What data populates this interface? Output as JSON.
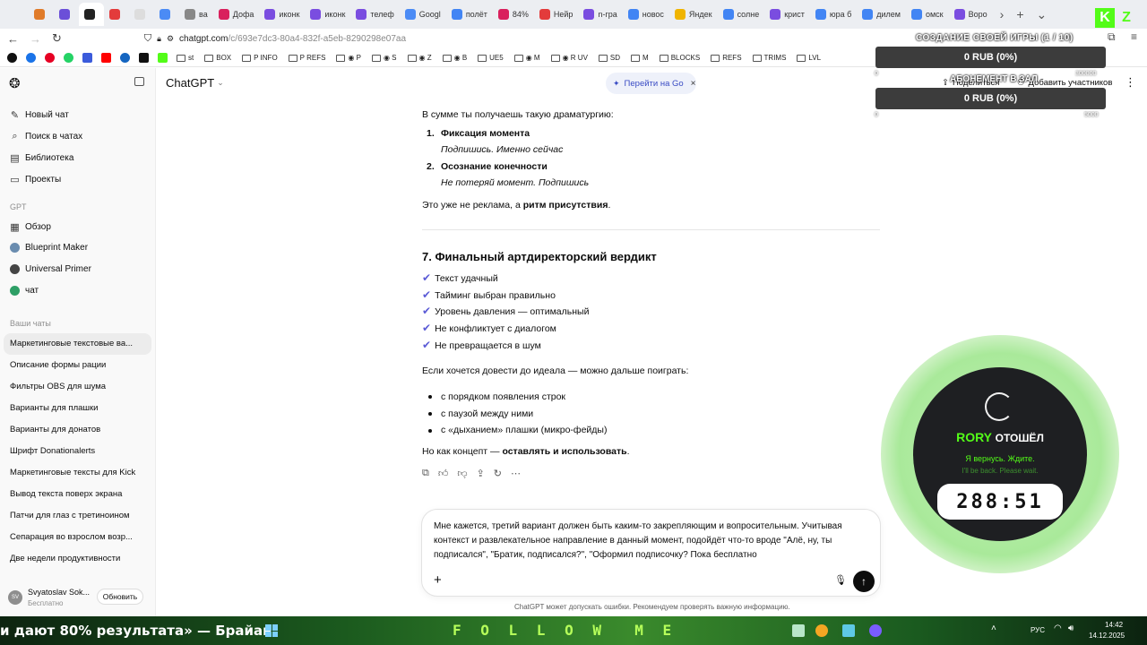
{
  "browser": {
    "tabs": [
      {
        "label": "",
        "color": "#e07b2a"
      },
      {
        "label": "",
        "color": "#6b4fd8"
      },
      {
        "label": "",
        "color": "#222222"
      },
      {
        "label": "",
        "color": "#e33b3b"
      },
      {
        "label": "",
        "color": "#dddddd"
      },
      {
        "label": "",
        "color": "#4b8bf5"
      },
      {
        "label": "вa",
        "color": "#888888"
      },
      {
        "label": "Дофа",
        "color": "#d9205d"
      },
      {
        "label": "иконк",
        "color": "#7a4de0"
      },
      {
        "label": "иконк",
        "color": "#7a4de0"
      },
      {
        "label": "телеф",
        "color": "#7a4de0"
      },
      {
        "label": "Googl",
        "color": "#4b8bf5"
      },
      {
        "label": "полёт",
        "color": "#4285f4"
      },
      {
        "label": "84% ",
        "color": "#d9205d"
      },
      {
        "label": "Нейр",
        "color": "#e33b3b"
      },
      {
        "label": "n-грa",
        "color": "#7a4de0"
      },
      {
        "label": "новос",
        "color": "#4285f4"
      },
      {
        "label": "Яндек",
        "color": "#f0b400"
      },
      {
        "label": "солне",
        "color": "#4285f4"
      },
      {
        "label": "крист",
        "color": "#7a4de0"
      },
      {
        "label": "юра б",
        "color": "#4285f4"
      },
      {
        "label": "дилем",
        "color": "#4285f4"
      },
      {
        "label": "омск ",
        "color": "#4285f4"
      },
      {
        "label": "Воро",
        "color": "#7a4de0"
      }
    ],
    "url_host": "chatgpt.com",
    "url_path": "/c/693e7dc3-80a4-832f-a5eb-8290298e07aa",
    "bookmarks": [
      "st",
      "BOX",
      "P INFO",
      "P REFS",
      "◉ P",
      "◉ S",
      "◉ Z",
      "◉ B",
      "UE5",
      "◉ M",
      "◉ R UV",
      "SD",
      "M",
      "BLOCKS",
      "REFS",
      "TRIMS",
      "LVL"
    ]
  },
  "sidebar": {
    "nav": [
      {
        "label": "Новый чат",
        "icon": "edit-icon"
      },
      {
        "label": "Поиск в чатах",
        "icon": "search-icon"
      },
      {
        "label": "Библиотека",
        "icon": "library-icon"
      },
      {
        "label": "Проекты",
        "icon": "folder-icon"
      }
    ],
    "gpt_section": "GPT",
    "gpts": [
      {
        "label": "Обзор",
        "icon": "grid-icon"
      },
      {
        "label": "Blueprint Maker",
        "icon": "blueprint-avatar"
      },
      {
        "label": "Universal Primer",
        "icon": "primer-avatar"
      },
      {
        "label": "чат",
        "icon": "chat-avatar"
      }
    ],
    "chats_section": "Ваши чаты",
    "chats": [
      "Маркетинговые текстовые ва...",
      "Описание формы рации",
      "Фильтры OBS для шума",
      "Варианты для плашки",
      "Варианты для донатов",
      "Шрифт Donationalerts",
      "Маркетинговые тексты для Kick",
      "Вывод текста поверх экрана",
      "Патчи для глаз с третиноином",
      "Сепарация во взрослом возр...",
      "Две недели продуктивности"
    ],
    "user_initials": "SV",
    "user_name": "Svyatoslav Sok...",
    "user_plan": "Бесплатно",
    "upgrade_label": "Обновить"
  },
  "header": {
    "model": "ChatGPT",
    "go_banner": "Перейти на Go",
    "share": "Поделиться",
    "add_participants": "Добавить участников"
  },
  "message": {
    "intro": "В сумме ты получаешь такую драматургию:",
    "ordered": [
      {
        "num": "1.",
        "title": "Фиксация момента",
        "sub": "Подпишись. Именно сейчас"
      },
      {
        "num": "2.",
        "title": "Осознание конечности",
        "sub": "Не потеряй момент. Подпишись"
      }
    ],
    "summary_pre": "Это уже не реклама, а ",
    "summary_bold": "ритм присутствия",
    "summary_post": ".",
    "section_title": "7. Финальный артдиректорский вердикт",
    "checks": [
      "Текст удачный",
      "Тайминг выбран правильно",
      "Уровень давления — оптимальный",
      "Не конфликтует с диалогом",
      "Не превращается в шум"
    ],
    "ideal_intro": "Если хочется довести до идеала — можно дальше поиграть:",
    "bullets": [
      "с порядком появления строк",
      "с паузой между ними",
      "с «дыханием» плашки (микро-фейды)"
    ],
    "closing_pre": "Но как концепт — ",
    "closing_bold": "оставлять и использовать",
    "closing_post": "."
  },
  "composer": {
    "text": "Мне кажется, третий вариант должен быть каким-то закрепляющим и вопросительным. Учитывая контекст и развлекательное направление в данный момент, подойдёт что-то вроде \"Алё, ну, ты подписался\", \"Братик, подписался?\", \"Оформил подписочку? Пока бесплатно",
    "disclaimer": "ChatGPT может допускать ошибки. Рекомендуем проверять важную информацию."
  },
  "overlay": {
    "goal1_title": "СОЗДАНИЕ СВОЕЙ ИГРЫ (1 / 10)",
    "goal1_value": "0 RUB (0%)",
    "goal2_title": "АБОНЕМЕНТ В ЗАЛ",
    "goal2_value": "0 RUB (0%)",
    "goal1_min": "0",
    "goal1_max": "300000",
    "goal2_min": "0",
    "goal2_max": "5000",
    "rory_name": "RORY",
    "rory_status": "ОТОШЁЛ",
    "rory_ru": "Я вернусь. Ждите.",
    "rory_en": "I'll be back. Please wait.",
    "timer": "288:51"
  },
  "taskbar": {
    "marquee": "и дают 80% результата» — Брайан",
    "follow": "F O L L O W  M E",
    "lang": "РУС",
    "time": "14:42",
    "date": "14.12.2025"
  }
}
